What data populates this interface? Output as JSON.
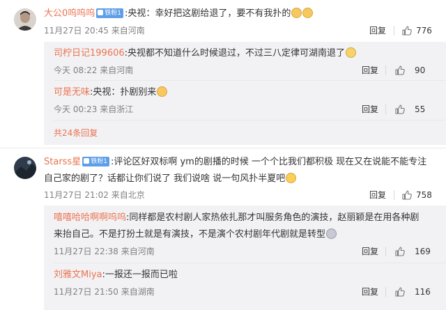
{
  "c1": {
    "name": "大公0呜呜呜",
    "badge": "铁粉1",
    "text": ":央视：幸好把这剧给退了，要不有我扑的",
    "meta": "11月27日 20:45 来自河南",
    "reply": "回复",
    "likes": "776",
    "subs": [
      {
        "name": "司柠日记199606",
        "text": ":央视都不知道什么时候退过，不过三八定律可湖南退了",
        "meta": "今天 08:22 来自河南",
        "reply": "回复",
        "likes": "90"
      },
      {
        "name": "可是无味",
        "text": ":央视：扑剧别来",
        "meta": "今天 00:23 来自浙江",
        "reply": "回复",
        "likes": "55"
      }
    ],
    "more": "共24条回复"
  },
  "c2": {
    "name": "Starss星",
    "badge": "铁粉1",
    "text1": ":评论区好双标啊 ym的剧播的时候 一个个比我们都积极 现在又在说能不能专注",
    "text2": "自己家的剧了？话都让你们说了 我们说啥 说一句风扑半夏吧",
    "meta": "11月27日 21:02 来自北京",
    "reply": "回复",
    "likes": "758",
    "subs": [
      {
        "name": "嘻嘻哈哈啊啊呜呜",
        "text1": ":同样都是农村剧人家热依扎那才叫服务角色的演技，赵丽颖是在用各种剧",
        "text2": "来抬自己。不是打扮土就是有演技，不是演个农村剧年代剧就是转型",
        "meta": "11月27日 22:38 来自河南",
        "reply": "回复",
        "likes": "169"
      },
      {
        "name": "刘雅文Miya",
        "text": ":一报还一报而已啦",
        "meta": "11月27日 21:50 来自湖南",
        "reply": "回复",
        "likes": "116"
      }
    ]
  }
}
